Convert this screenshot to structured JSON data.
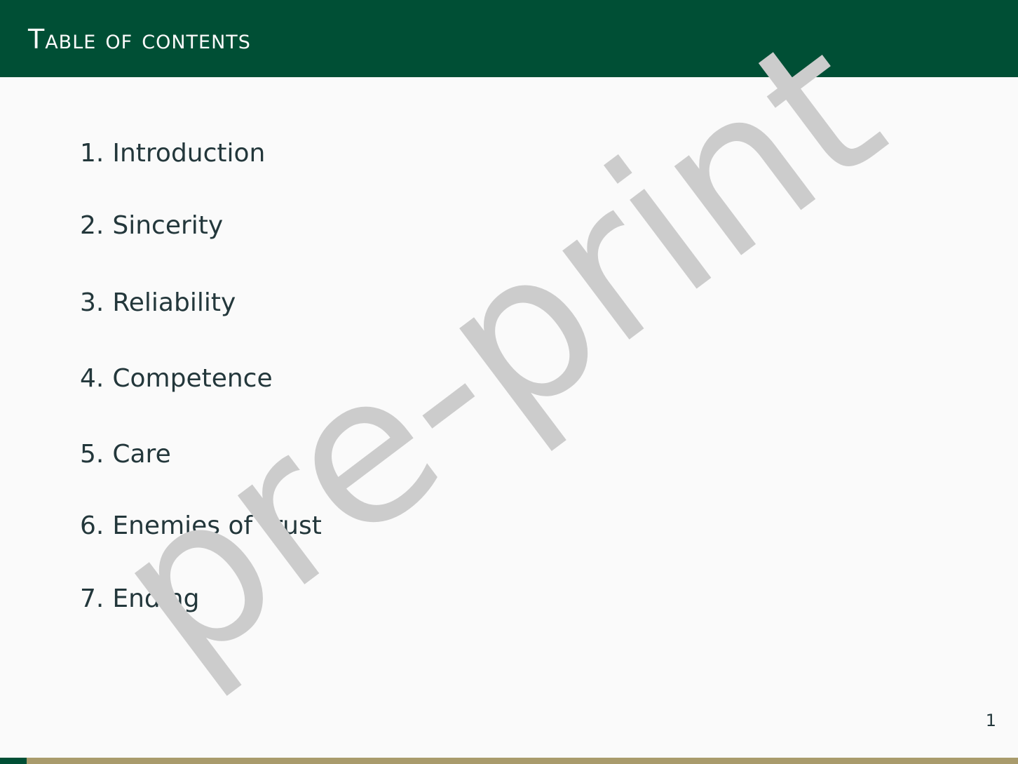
{
  "header": {
    "title": "Table of contents",
    "background_color": "#004f35"
  },
  "toc": {
    "items": [
      {
        "number": "1.",
        "label": "Introduction"
      },
      {
        "number": "2.",
        "label": "Sincerity"
      },
      {
        "number": "3.",
        "label": "Reliability"
      },
      {
        "number": "4.",
        "label": "Competence"
      },
      {
        "number": "5.",
        "label": "Care"
      },
      {
        "number": "6.",
        "label": "Enemies of Trust"
      },
      {
        "number": "7.",
        "label": "Ending"
      }
    ]
  },
  "watermark": {
    "text": "pre-print",
    "color": "#cccccc"
  },
  "footer": {
    "page_number": "1",
    "progress_fraction": 0.026,
    "progress_color": "#004f35",
    "track_color": "#a99b6c"
  }
}
